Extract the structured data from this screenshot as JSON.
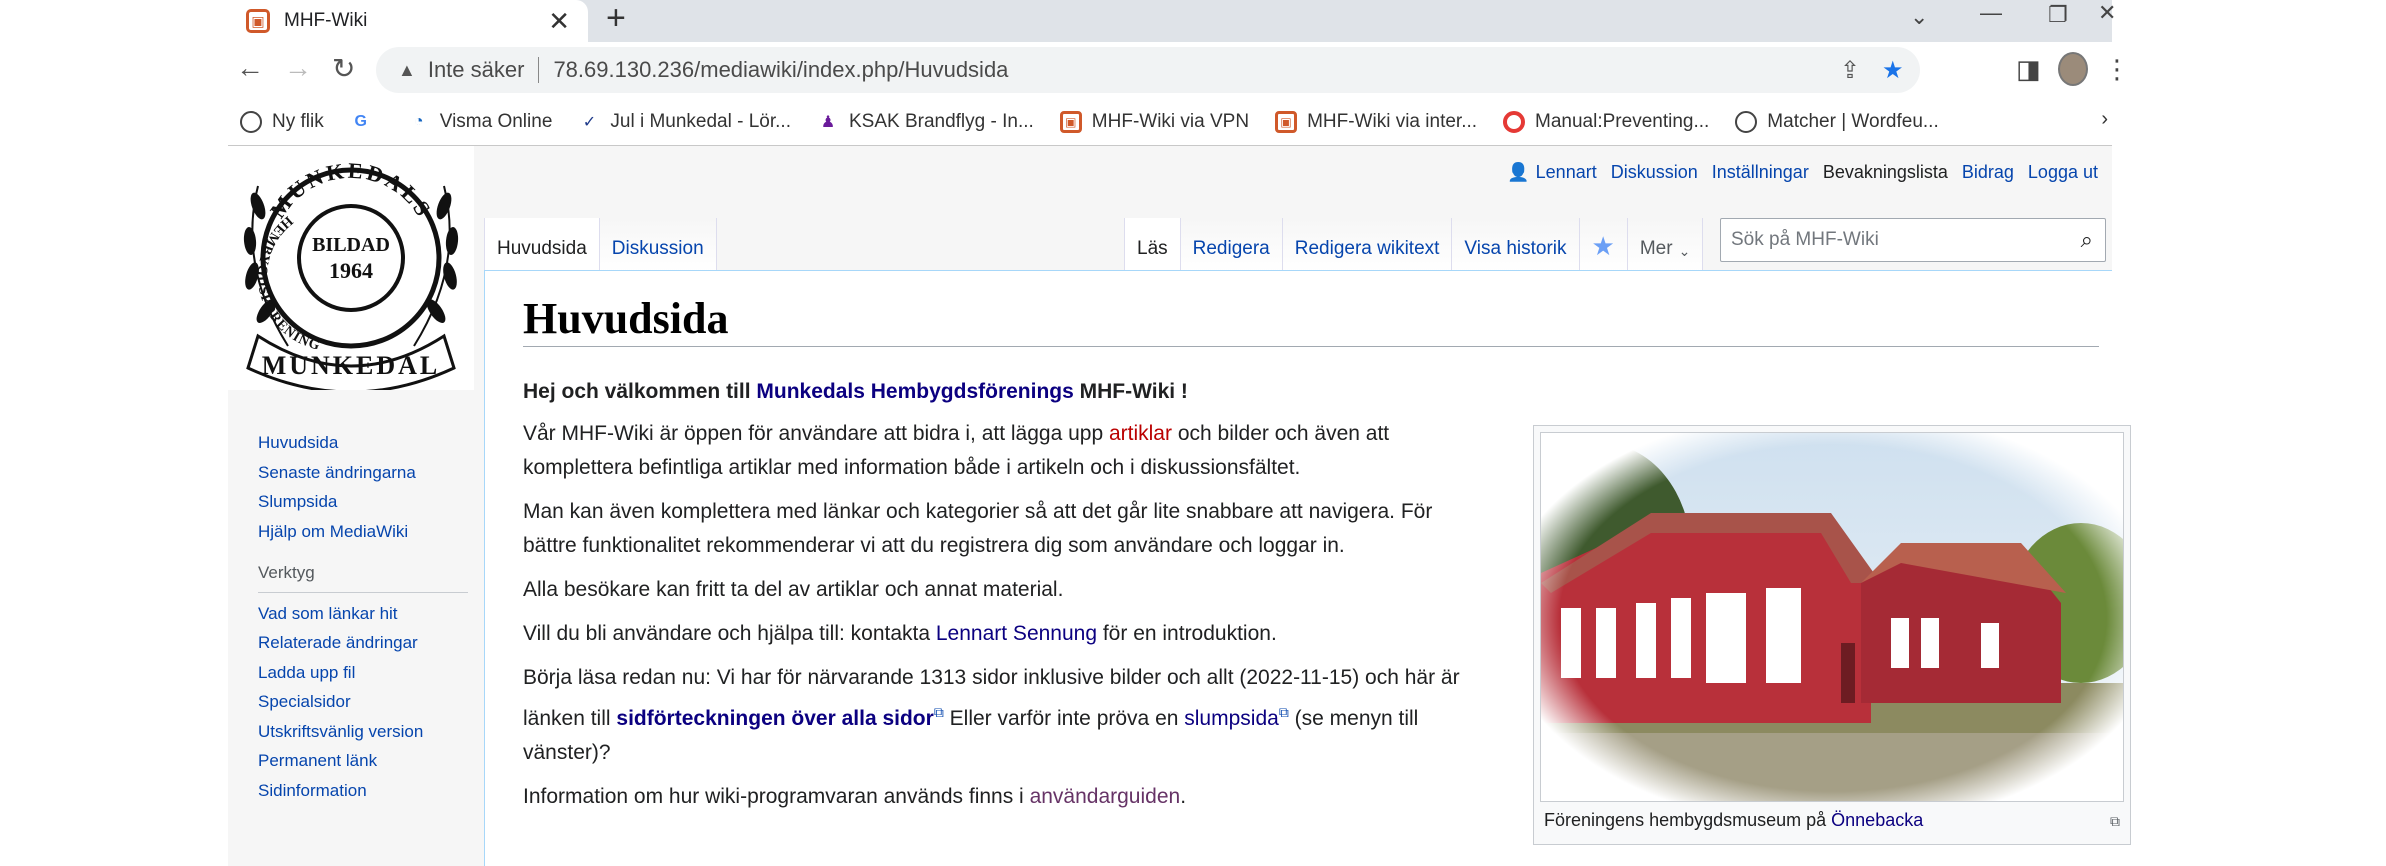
{
  "browser": {
    "tab_title": "MHF-Wiki",
    "tab_close": "✕",
    "new_tab": "+",
    "not_secure": "Inte säker",
    "url": "78.69.130.236/mediawiki/index.php/Huvudsida",
    "bookmarks": [
      {
        "label": "Ny flik",
        "icon": "globe"
      },
      {
        "label": "",
        "icon": "g"
      },
      {
        "label": "Visma Online",
        "icon": "visma"
      },
      {
        "label": "Jul i Munkedal - Lör...",
        "icon": "doc"
      },
      {
        "label": "KSAK Brandflyg - In...",
        "icon": "ksak"
      },
      {
        "label": "MHF-Wiki via VPN",
        "icon": "mhf"
      },
      {
        "label": "MHF-Wiki via inter...",
        "icon": "mhf"
      },
      {
        "label": "Manual:Preventing...",
        "icon": "opera"
      },
      {
        "label": "Matcher | Wordfeu...",
        "icon": "globe"
      }
    ]
  },
  "logo": {
    "top_text": "MUNKEDALS",
    "left_text": "HEMBYGDSFÖRENING",
    "center_top": "BILDAD",
    "center_year": "1964",
    "banner": "MUNKEDAL"
  },
  "personal": {
    "user": "Lennart",
    "discussion": "Diskussion",
    "settings": "Inställningar",
    "watchlist": "Bevakningslista",
    "contributions": "Bidrag",
    "logout": "Logga ut"
  },
  "tabs": {
    "page": "Huvudsida",
    "talk": "Diskussion",
    "read": "Läs",
    "edit": "Redigera",
    "edit_source": "Redigera wikitext",
    "history": "Visa historik",
    "more": "Mer"
  },
  "search": {
    "placeholder": "Sök på MHF-Wiki"
  },
  "sidebar": {
    "nav": [
      "Huvudsida",
      "Senaste ändringarna",
      "Slumpsida",
      "Hjälp om MediaWiki"
    ],
    "tools_heading": "Verktyg",
    "tools": [
      "Vad som länkar hit",
      "Relaterade ändringar",
      "Ladda upp fil",
      "Specialsidor",
      "Utskriftsvänlig version",
      "Permanent länk",
      "Sidinformation"
    ]
  },
  "page": {
    "title": "Huvudsida",
    "lead_pre": "Hej och välkommen till ",
    "lead_link": "Munkedals Hembygdsförenings",
    "lead_post": " MHF-Wiki !",
    "p1_pre": "Vår MHF-Wiki är öppen för användare att bidra i, att lägga upp ",
    "p1_link": "artiklar",
    "p1_post": " och bilder och även att komplettera befintliga artiklar med information både i artikeln och i diskussionsfältet.",
    "p2": "Man kan även komplettera med länkar och kategorier så att det går lite snabbare att navigera. För bättre funktionalitet rekommenderar vi att du registrera dig som användare och loggar in.",
    "p3": "Alla besökare kan fritt ta del av artiklar och annat material.",
    "p4_pre": "Vill du bli användare och hjälpa till: kontakta ",
    "p4_link": "Lennart Sennung",
    "p4_post": " för en introduktion.",
    "p5_pre": "Börja läsa redan nu: Vi har för närvarande 1313 sidor inklusive bilder och allt (2022-11-15) och här är länken till ",
    "p5_link1": "sidförteckningen över alla sidor",
    "p5_mid": " Eller varför inte pröva en ",
    "p5_link2": "slumpsida",
    "p5_post": " (se menyn till vänster)?",
    "p6_pre": "Information om hur wiki-programvaran används finns i ",
    "p6_link": "användarguiden",
    "p6_post": ".",
    "caption_pre": "Föreningens hembygdsmuseum på ",
    "caption_link": "Önnebacka"
  }
}
